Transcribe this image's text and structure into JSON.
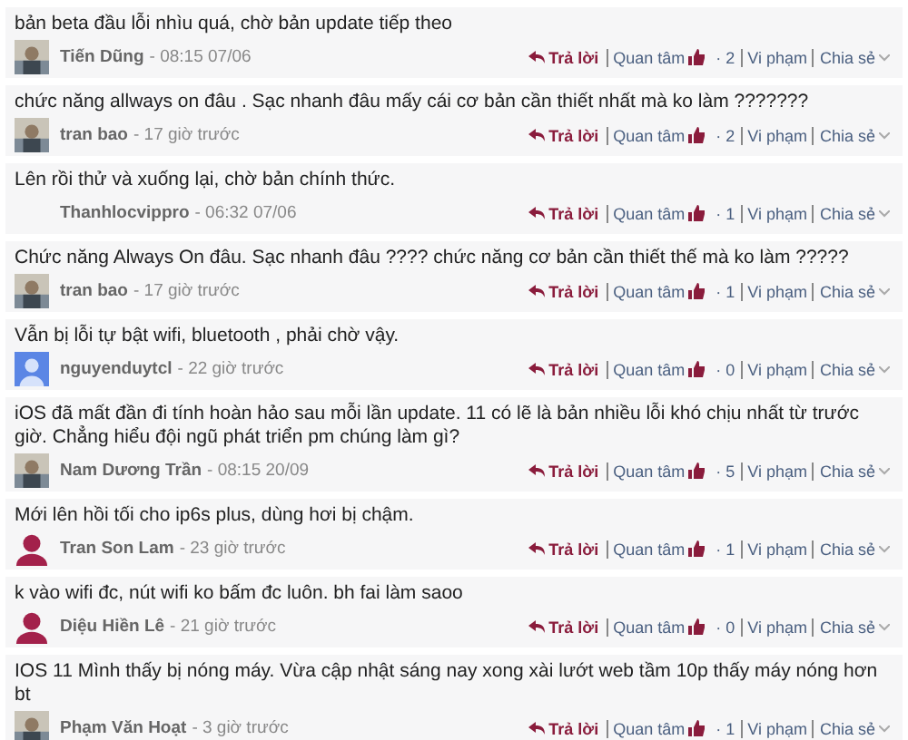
{
  "comments": [
    {
      "text": "bản beta đầu lỗi nhìu quá, chờ bản update tiếp theo",
      "author": "Tiến Dũng",
      "time": "- 08:15 07/06",
      "reply": "Trả lời",
      "like": "Quan tâm",
      "likes": "· 2",
      "report": "Vi phạm",
      "share": "Chia sẻ"
    },
    {
      "text": "chức năng allways on đâu . Sạc nhanh đâu mấy cái cơ bản cần thiết nhất mà ko làm ???????",
      "author": "tran bao",
      "time": "- 17 giờ trước",
      "reply": "Trả lời",
      "like": "Quan tâm",
      "likes": "· 2",
      "report": "Vi phạm",
      "share": "Chia sẻ"
    },
    {
      "text": "Lên rồi thử và xuống lại, chờ bản chính thức.",
      "author": "Thanhlocvippro",
      "time": "- 06:32 07/06",
      "reply": "Trả lời",
      "like": "Quan tâm",
      "likes": "· 1",
      "report": "Vi phạm",
      "share": "Chia sẻ"
    },
    {
      "text": "Chức năng Always On đâu. Sạc nhanh đâu ???? chức năng cơ bản cần thiết thế mà ko làm ?????",
      "author": "tran bao",
      "time": "- 17 giờ trước",
      "reply": "Trả lời",
      "like": "Quan tâm",
      "likes": "· 1",
      "report": "Vi phạm",
      "share": "Chia sẻ"
    },
    {
      "text": "Vẫn bị lỗi tự bật wifi, bluetooth , phải chờ vậy.",
      "author": "nguyenduytcl",
      "time": "- 22 giờ trước",
      "avatar": {
        "kind": "default"
      },
      "reply": "Trả lời",
      "like": "Quan tâm",
      "likes": "· 0",
      "report": "Vi phạm",
      "share": "Chia sẻ"
    },
    {
      "text": "iOS đã mất đần đi tính hoàn hảo sau mỗi lần update. 11 có lẽ là bản nhiều lỗi khó chịu nhất từ trước giờ. Chẳng hiểu đội ngũ phát triển pm chúng làm gì?",
      "author": "Nam Dương Trần",
      "time": "- 08:15 20/09",
      "reply": "Trả lời",
      "like": "Quan tâm",
      "likes": "· 5",
      "report": "Vi phạm",
      "share": "Chia sẻ"
    },
    {
      "text": "Mới lên hồi tối cho ip6s plus, dùng hơi bị chậm.",
      "author": "Tran Son Lam",
      "time": "- 23 giờ trước",
      "avatar": {
        "kind": "member"
      },
      "reply": "Trả lời",
      "like": "Quan tâm",
      "likes": "· 1",
      "report": "Vi phạm",
      "share": "Chia sẻ"
    },
    {
      "text": "k vào wifi đc, nút wifi ko bấm đc luôn. bh fai làm saoo",
      "author": "Diệu Hiền Lê",
      "time": "- 21 giờ trước",
      "avatar": {
        "kind": "member"
      },
      "reply": "Trả lời",
      "like": "Quan tâm",
      "likes": "· 0",
      "report": "Vi phạm",
      "share": "Chia sẻ"
    },
    {
      "text": "IOS 11 Mình thấy bị nóng máy. Vừa cập nhật sáng nay xong xài lướt web tầm 10p thấy máy nóng hơn bt",
      "author": "Phạm Văn Hoạt",
      "time": "- 3 giờ trước",
      "reply": "Trả lời",
      "like": "Quan tâm",
      "likes": "· 1",
      "report": "Vi phạm",
      "share": "Chia sẻ"
    }
  ]
}
